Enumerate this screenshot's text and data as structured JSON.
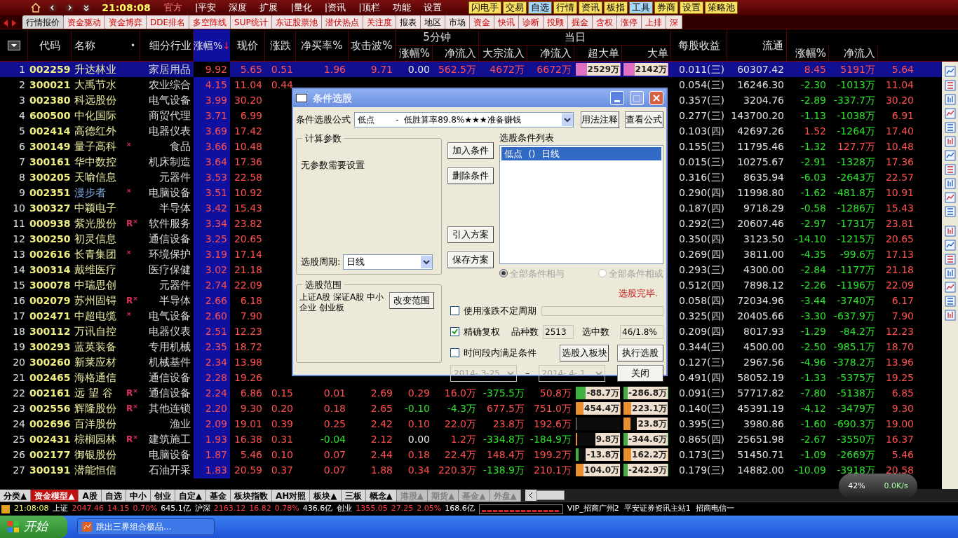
{
  "toolbar": {
    "time": "21:08:08",
    "menus": [
      "官方",
      "|平安",
      "深度",
      "扩展",
      "|量化",
      "|资讯",
      "|顶栏",
      "功能",
      "设置"
    ],
    "buttons": [
      {
        "label": "闪电手",
        "color": "#f8e060"
      },
      {
        "label": "交易",
        "color": "#f8e060"
      },
      {
        "label": "自选",
        "color": "#a8d8f8"
      },
      {
        "label": "行情",
        "color": "#f8e060"
      },
      {
        "label": "资讯",
        "color": "#f8e060"
      },
      {
        "label": "板指",
        "color": "#f8e060"
      },
      {
        "label": "工具",
        "color": "#a8d8f8"
      },
      {
        "label": "券商",
        "color": "#f8e060"
      },
      {
        "label": "设置",
        "color": "#f8e060"
      },
      {
        "label": "策略池",
        "color": "#f8e060"
      }
    ]
  },
  "tabs": [
    {
      "label": "行情报价",
      "selected": true,
      "kind": "plain"
    },
    {
      "label": "资金驱动",
      "selected": false,
      "kind": "feature"
    },
    {
      "label": "资金博弈",
      "selected": false,
      "kind": "feature"
    },
    {
      "label": "DDE排名",
      "selected": false,
      "kind": "feature"
    },
    {
      "label": "多空阵线",
      "selected": false,
      "kind": "feature"
    },
    {
      "label": "SUP统计",
      "selected": false,
      "kind": "feature"
    },
    {
      "label": "东证股票池",
      "selected": false,
      "kind": "feature"
    },
    {
      "label": "潜伏热点",
      "selected": false,
      "kind": "feature"
    },
    {
      "label": "关注度",
      "selected": false,
      "kind": "feature"
    },
    {
      "label": "报表",
      "selected": false,
      "kind": "plain"
    },
    {
      "label": "地区",
      "selected": false,
      "kind": "plain"
    },
    {
      "label": "市场",
      "selected": false,
      "kind": "plain"
    },
    {
      "label": "资金",
      "selected": false,
      "kind": "feature"
    },
    {
      "label": "快讯",
      "selected": false,
      "kind": "feature"
    },
    {
      "label": "诊断",
      "selected": false,
      "kind": "feature"
    },
    {
      "label": "投顾",
      "selected": false,
      "kind": "feature"
    },
    {
      "label": "掘金",
      "selected": false,
      "kind": "feature"
    },
    {
      "label": "含权",
      "selected": false,
      "kind": "feature"
    },
    {
      "label": "涨停",
      "selected": false,
      "kind": "feature"
    },
    {
      "label": "上排",
      "selected": false,
      "kind": "feature"
    },
    {
      "label": "深",
      "selected": false,
      "kind": "feature"
    }
  ],
  "table": {
    "columns": {
      "code": "代码",
      "name": "名称",
      "name_dot": "•",
      "industry": "细分行业",
      "change": "涨幅%",
      "sort_arrow": "↓",
      "price": "现价",
      "diff": "涨跌",
      "net_buy": "净买率%",
      "attack": "攻击波%",
      "group_5min": "5分钟",
      "m5_change": "涨幅%",
      "m5_inflow": "净流入",
      "group_today": "当日",
      "block_inflow": "大宗流入",
      "inflow": "净流入",
      "super_order": "超大单",
      "big_order": "大单",
      "eps": "每股收益",
      "float": "流通",
      "change_2": "涨幅%",
      "inflow_2": "净流入"
    },
    "rows": [
      {
        "no": "1",
        "code": "002259",
        "name": "升达林业",
        "industry": "家居用品",
        "change": "9.92",
        "price": "5.65",
        "diff": "0.51",
        "net_buy": "1.96",
        "attack": "9.71",
        "m5_change": "0.00",
        "m5_inflow": "562.5万",
        "block_inflow": "4672万",
        "inflow": "6672万",
        "super_order": {
          "text": "2529万",
          "level": 1,
          "color": "#e070c0"
        },
        "big_order": {
          "text": "2142万",
          "level": 1,
          "color": "#e070c0"
        },
        "eps": "0.011(三)",
        "float": "60307.42",
        "change_2": "8.45",
        "inflow_2": "5191万",
        "column_21": "5.64",
        "selected": true
      },
      {
        "no": "2",
        "code": "300021",
        "name": "大禹节水",
        "industry": "农业综合",
        "change": "4.15",
        "price": "11.04",
        "diff": "0.44",
        "eps": "0.054(三)",
        "float": "16246.30",
        "change_2": "-2.30",
        "inflow_2": "-1013万",
        "column_21": "11.04",
        "selected": false
      },
      {
        "no": "3",
        "code": "002380",
        "name": "科远股份",
        "industry": "电气设备",
        "change": "3.99",
        "price": "30.20",
        "eps": "0.357(三)",
        "float": "3204.76",
        "change_2": "-2.89",
        "inflow_2": "-337.7万",
        "column_21": "30.20",
        "selected": false
      },
      {
        "no": "4",
        "code": "600500",
        "name": "中化国际",
        "industry": "商贸代理",
        "change": "3.71",
        "price": "6.99",
        "eps": "0.277(三)",
        "float": "143700.20",
        "change_2": "-1.13",
        "inflow_2": "-1038万",
        "column_21": "6.91",
        "selected": false
      },
      {
        "no": "5",
        "code": "002414",
        "name": "高德红外",
        "industry": "电器仪表",
        "change": "3.69",
        "price": "17.42",
        "eps": "0.103(四)",
        "float": "42697.26",
        "change_2": "1.52",
        "inflow_2": "-1264万",
        "column_21": "17.40",
        "selected": false
      },
      {
        "no": "6",
        "code": "300149",
        "name": "量子高科",
        "mark": "$^{×}$",
        "industry": "食品",
        "change": "3.66",
        "price": "10.48",
        "eps": "0.155(三)",
        "float": "11795.46",
        "change_2": "-1.32",
        "inflow_2": "127.7万",
        "column_21": "10.48",
        "selected": false
      },
      {
        "no": "7",
        "code": "300161",
        "name": "华中数控",
        "industry": "机床制造",
        "change": "3.64",
        "price": "17.36",
        "eps": "0.015(三)",
        "float": "10275.67",
        "change_2": "-2.91",
        "inflow_2": "-1328万",
        "column_21": "17.36",
        "selected": false
      },
      {
        "no": "8",
        "code": "300205",
        "name": "天喻信息",
        "industry": "元器件",
        "change": "3.53",
        "price": "22.58",
        "eps": "0.316(三)",
        "float": "8635.94",
        "change_2": "-6.03",
        "inflow_2": "-2643万",
        "column_21": "22.57",
        "selected": false
      },
      {
        "no": "9",
        "code": "002351",
        "name": "漫步者",
        "color": "#7aa7e0",
        "mark": "$^{×}$",
        "industry": "电脑设备",
        "change": "3.51",
        "price": "10.92",
        "eps": "0.290(四)",
        "float": "11998.80",
        "change_2": "-1.62",
        "inflow_2": "-481.8万",
        "column_21": "10.91",
        "selected": false
      },
      {
        "no": "10",
        "code": "300327",
        "name": "中颖电子",
        "industry": "半导体",
        "change": "3.42",
        "price": "15.43",
        "eps": "0.187(四)",
        "float": "9718.29",
        "change_2": "-0.58",
        "inflow_2": "-1286万",
        "column_21": "15.43",
        "selected": false
      },
      {
        "no": "11",
        "code": "000938",
        "name": "紫光股份",
        "mark": "R$^{×}$",
        "industry": "软件服务",
        "change": "3.34",
        "price": "23.82",
        "eps": "0.292(三)",
        "float": "20607.46",
        "change_2": "-2.97",
        "inflow_2": "-1731万",
        "column_21": "23.81",
        "selected": false
      },
      {
        "no": "12",
        "code": "300250",
        "name": "初灵信息",
        "industry": "通信设备",
        "change": "3.25",
        "price": "20.65",
        "eps": "0.350(四)",
        "float": "3123.50",
        "change_2": "-14.10",
        "inflow_2": "-1215万",
        "column_21": "20.65",
        "selected": false
      },
      {
        "no": "13",
        "code": "002616",
        "name": "长青集团",
        "mark": "$^{×}$",
        "industry": "环境保护",
        "change": "3.19",
        "price": "17.14",
        "eps": "0.269(四)",
        "float": "3811.00",
        "change_2": "-4.35",
        "inflow_2": "-99.6万",
        "column_21": "17.13",
        "selected": false
      },
      {
        "no": "14",
        "code": "300314",
        "name": "戴维医疗",
        "industry": "医疗保健",
        "change": "3.02",
        "price": "21.18",
        "eps": "0.293(三)",
        "float": "4300.00",
        "change_2": "-2.84",
        "inflow_2": "-1177万",
        "column_21": "21.18",
        "selected": false
      },
      {
        "no": "15",
        "code": "300078",
        "name": "中瑞思创",
        "industry": "元器件",
        "change": "2.74",
        "price": "22.09",
        "eps": "0.512(四)",
        "float": "7898.12",
        "change_2": "-2.26",
        "inflow_2": "-1196万",
        "column_21": "22.09",
        "selected": false
      },
      {
        "no": "16",
        "code": "002079",
        "name": "苏州固锝",
        "mark": "R$^{×}$",
        "industry": "半导体",
        "change": "2.66",
        "price": "6.18",
        "eps": "0.058(四)",
        "float": "72034.96",
        "change_2": "-3.44",
        "inflow_2": "-3740万",
        "column_21": "6.17",
        "selected": false
      },
      {
        "no": "17",
        "code": "002471",
        "name": "中超电缆",
        "mark": "$^{×}$",
        "industry": "电气设备",
        "change": "2.60",
        "price": "7.90",
        "eps": "0.325(四)",
        "float": "20405.66",
        "change_2": "-3.30",
        "inflow_2": "-637.9万",
        "column_21": "7.90",
        "selected": false
      },
      {
        "no": "18",
        "code": "300112",
        "name": "万讯自控",
        "industry": "电器仪表",
        "change": "2.51",
        "price": "12.23",
        "eps": "0.209(四)",
        "float": "8017.93",
        "change_2": "-1.29",
        "inflow_2": "-84.2万",
        "column_21": "12.23",
        "selected": false
      },
      {
        "no": "19",
        "code": "300293",
        "name": "蓝英装备",
        "industry": "专用机械",
        "change": "2.35",
        "price": "18.72",
        "eps": "0.344(三)",
        "float": "4500.00",
        "change_2": "-2.50",
        "inflow_2": "-985.1万",
        "column_21": "18.70",
        "selected": false
      },
      {
        "no": "20",
        "code": "300260",
        "name": "新莱应材",
        "industry": "机械基件",
        "change": "2.34",
        "price": "13.98",
        "eps": "0.127(三)",
        "float": "2967.56",
        "change_2": "-4.96",
        "inflow_2": "-378.2万",
        "column_21": "13.96",
        "selected": false
      },
      {
        "no": "21",
        "code": "002465",
        "name": "海格通信",
        "industry": "通信设备",
        "change": "2.28",
        "price": "19.26",
        "eps": "0.491(四)",
        "float": "58052.19",
        "change_2": "-1.33",
        "inflow_2": "-5375万",
        "column_21": "19.25",
        "selected": false
      },
      {
        "no": "22",
        "code": "002161",
        "name": "远 望 谷",
        "mark": "R$^{×}$",
        "industry": "通信设备",
        "change": "2.24",
        "price": "6.86",
        "diff": "0.15",
        "net_buy": "0.01",
        "attack": "2.69",
        "m5_change": "0.29",
        "m5_inflow": "16.0万",
        "block_inflow": "-375.5万",
        "inflow": "50.8万",
        "super_order": {
          "text": "-88.7万",
          "level": 0.3,
          "color": "#40b040"
        },
        "big_order": {
          "text": "-286.8万",
          "level": 1,
          "color": "#40b040"
        },
        "eps": "0.091(三)",
        "float": "57717.82",
        "change_2": "-7.80",
        "inflow_2": "-5138万",
        "column_21": "6.85",
        "selected": false
      },
      {
        "no": "23",
        "code": "002556",
        "name": "辉隆股份",
        "mark": "R$^{×}$",
        "industry": "其他连锁",
        "change": "2.20",
        "price": "9.30",
        "diff": "0.20",
        "net_buy": "0.18",
        "attack": "2.65",
        "m5_change": "-0.10",
        "m5_inflow": "-4.3万",
        "block_inflow": "677.5万",
        "inflow": "751.0万",
        "super_order": {
          "text": "454.4万",
          "level": 1,
          "color": "#e89030"
        },
        "big_order": {
          "text": "223.1万",
          "level": 0.5,
          "color": "#e89030"
        },
        "eps": "0.140(三)",
        "float": "45391.19",
        "change_2": "-4.12",
        "inflow_2": "-3479万",
        "column_21": "9.30",
        "selected": false
      },
      {
        "no": "24",
        "code": "002696",
        "name": "百洋股份",
        "industry": "渔业",
        "change": "2.09",
        "price": "19.01",
        "diff": "0.39",
        "net_buy": "0.25",
        "attack": "2.42",
        "m5_change": "0.10",
        "m5_inflow": "22.0万",
        "block_inflow": "23.8万",
        "inflow": "192.6万",
        "super_order": {
          "level": 0.02,
          "color": "#a0a0a0"
        },
        "big_order": {
          "text": "23.8万",
          "level": 0.15,
          "color": "#e89030"
        },
        "eps": "0.395(三)",
        "float": "3980.86",
        "change_2": "-1.60",
        "inflow_2": "-690.3万",
        "column_21": "19.00",
        "selected": false
      },
      {
        "no": "25",
        "code": "002431",
        "name": "棕榈园林",
        "mark": "R$^{×}$",
        "industry": "建筑施工",
        "change": "1.93",
        "price": "16.38",
        "diff": "0.31",
        "net_buy": "-0.04",
        "attack": "2.12",
        "m5_change": "0.00",
        "m5_inflow": "1.2万",
        "block_inflow": "-334.8万",
        "inflow": "-184.9万",
        "super_order": {
          "text": "9.8万",
          "level": 0.03,
          "color": "#e89030"
        },
        "big_order": {
          "text": "-344.6万",
          "level": 1,
          "color": "#40b040"
        },
        "eps": "0.865(四)",
        "float": "25651.98",
        "change_2": "-2.67",
        "inflow_2": "-3550万",
        "column_21": "16.37",
        "selected": false
      },
      {
        "no": "26",
        "code": "002177",
        "name": "御银股份",
        "industry": "电脑设备",
        "change": "1.87",
        "price": "5.46",
        "diff": "0.10",
        "net_buy": "0.07",
        "attack": "2.44",
        "m5_change": "0.18",
        "m5_inflow": "22.4万",
        "block_inflow": "148.4万",
        "inflow": "199.2万",
        "super_order": {
          "text": "-13.8万",
          "level": 0.06,
          "color": "#40b040"
        },
        "big_order": {
          "text": "162.2万",
          "level": 1,
          "color": "#e89030"
        },
        "eps": "0.173(三)",
        "float": "51450.71",
        "change_2": "-1.09",
        "inflow_2": "-2669万",
        "column_21": "5.46",
        "selected": false
      },
      {
        "no": "27",
        "code": "300191",
        "name": "潜能恒信",
        "industry": "石油开采",
        "change": "1.83",
        "price": "20.59",
        "diff": "0.37",
        "net_buy": "0.07",
        "attack": "1.88",
        "m5_change": "0.34",
        "m5_inflow": "220.3万",
        "block_inflow": "-138.9万",
        "inflow": "210.1万",
        "super_order": {
          "text": "104.0万",
          "level": 0.45,
          "color": "#e89030"
        },
        "big_order": {
          "text": "-242.9万",
          "level": 1,
          "color": "#40b040"
        },
        "eps": "0.179(三)",
        "float": "14882.00",
        "change_2": "-10.09",
        "inflow_2": "-3918万",
        "column_21": "20.58",
        "selected": false
      }
    ]
  },
  "dialog": {
    "title": "条件选股",
    "formula_label": "条件选股公式",
    "formula": "低点        -  低胜算率89.8%★★★准备赚钱",
    "usage_button": "用法注释",
    "view_button": "查看公式",
    "params_group": "计算参数",
    "params_text": "无参数需要设置",
    "period_label": "选股周期:",
    "period": "日线",
    "action_buttons": [
      "加入条件",
      "删除条件",
      "引入方案",
      "保存方案"
    ],
    "list_label": "选股条件列表",
    "conditions": [
      {
        "label": "低点  ()  日线",
        "selected": true
      }
    ],
    "logic": [
      {
        "label": "全部条件相与",
        "selected": true
      },
      {
        "label": "全部条件相或",
        "selected": false
      }
    ],
    "status": "选股完毕.",
    "scope_group": "选股范围",
    "scope_text": "上证A股 深证A股 中小企业 创业板",
    "scope_button": "改变范围",
    "options": [
      {
        "label": "使用涨跌不定周期",
        "checked": false
      },
      {
        "label": "精确复权",
        "checked": true
      },
      {
        "label": "时间段内满足条件",
        "checked": false
      }
    ],
    "count_label": "品种数",
    "count": "2513",
    "picked_label": "选中数",
    "picked": "46/1.8%",
    "block_button": "选股入板块",
    "run_button": "执行选股",
    "close_button": "关闭",
    "date_from": "2014- 3-25",
    "date_sep": "–",
    "date_to": "2014- 4- 1"
  },
  "bottom_tabs": [
    {
      "label": "分类▲",
      "selected": false,
      "disabled": false
    },
    {
      "label": "资金模型▲",
      "selected": true,
      "disabled": false
    },
    {
      "label": "A股",
      "selected": false,
      "disabled": false
    },
    {
      "label": "自选",
      "selected": false,
      "disabled": false
    },
    {
      "label": "中小",
      "selected": false,
      "disabled": false
    },
    {
      "label": "创业",
      "selected": false,
      "disabled": false
    },
    {
      "label": "自定▲",
      "selected": false,
      "disabled": false
    },
    {
      "label": "基金",
      "selected": false,
      "disabled": false
    },
    {
      "label": "板块指数",
      "selected": false,
      "disabled": false
    },
    {
      "label": "AH对照",
      "selected": false,
      "disabled": false
    },
    {
      "label": "板块▲",
      "selected": false,
      "disabled": false
    },
    {
      "label": "三板",
      "selected": false,
      "disabled": false
    },
    {
      "label": "概念▲",
      "selected": false,
      "disabled": false
    },
    {
      "label": "港股▲",
      "selected": false,
      "disabled": true
    },
    {
      "label": "期货▲",
      "selected": false,
      "disabled": true
    },
    {
      "label": "基金▲",
      "selected": false,
      "disabled": true
    },
    {
      "label": "外盘▲",
      "selected": false,
      "disabled": true
    }
  ],
  "net_widget": {
    "percent": "42%",
    "speed": "0.0K/s"
  },
  "status_bar": {
    "time": "21:08:08",
    "indices": [
      {
        "name": "上证",
        "value": "2047.46",
        "change": "14.15",
        "pct": "0.70%",
        "amount": "645.1亿"
      },
      {
        "name": "沪深",
        "value": "2163.12",
        "change": "16.82",
        "pct": "0.78%",
        "amount": "436.6亿"
      },
      {
        "name": "创业",
        "value": "1355.05",
        "change": "27.25",
        "pct": "2.05%",
        "amount": "168.6亿"
      }
    ],
    "servers": "VIP_招商广州2  平安证券资讯主站1  招商电信一"
  },
  "taskbar": {
    "start": "开始",
    "task": "跳出三界组合极品..."
  }
}
